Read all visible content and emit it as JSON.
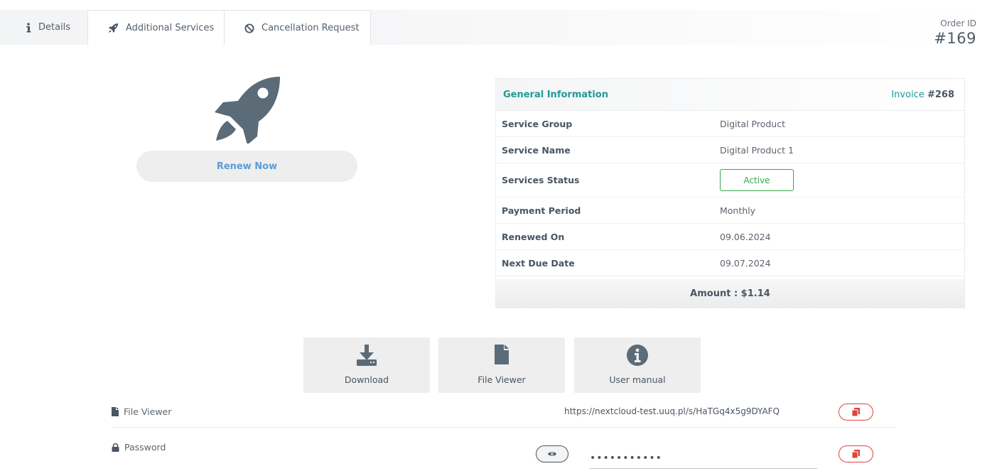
{
  "tabs": [
    {
      "label": "Details",
      "icon": "info-icon"
    },
    {
      "label": "Additional Services",
      "icon": "rocket-icon"
    },
    {
      "label": "Cancellation Request",
      "icon": "ban-icon"
    }
  ],
  "order": {
    "label": "Order ID",
    "value": "#169"
  },
  "hero": {
    "icon": "rocket-icon",
    "renew_label": "Renew Now"
  },
  "info": {
    "title": "General Information",
    "invoice_prefix": "Invoice ",
    "invoice_number": "#268",
    "rows": [
      {
        "key": "Service Group",
        "value": "Digital Product"
      },
      {
        "key": "Service Name",
        "value": "Digital Product 1"
      },
      {
        "key": "Services Status",
        "value": "Active"
      },
      {
        "key": "Payment Period",
        "value": "Monthly"
      },
      {
        "key": "Renewed On",
        "value": "09.06.2024"
      },
      {
        "key": "Next Due Date",
        "value": "09.07.2024"
      }
    ],
    "amount": "Amount : $1.14"
  },
  "actions": [
    {
      "label": "Download",
      "icon": "download-icon"
    },
    {
      "label": "File Viewer",
      "icon": "file-icon"
    },
    {
      "label": "User manual",
      "icon": "info-circle-icon"
    }
  ],
  "file_viewer": {
    "label": "File Viewer",
    "url": "https://nextcloud-test.uuq.pl/s/HaTGq4x5g9DYAFQ"
  },
  "password": {
    "label": "Password",
    "value": "•••••••••••"
  },
  "colors": {
    "accent": "#1e9a97",
    "active": "#38a84a",
    "copy": "#e0443e",
    "link": "#5a9bd8",
    "icon": "#5b6b78"
  }
}
